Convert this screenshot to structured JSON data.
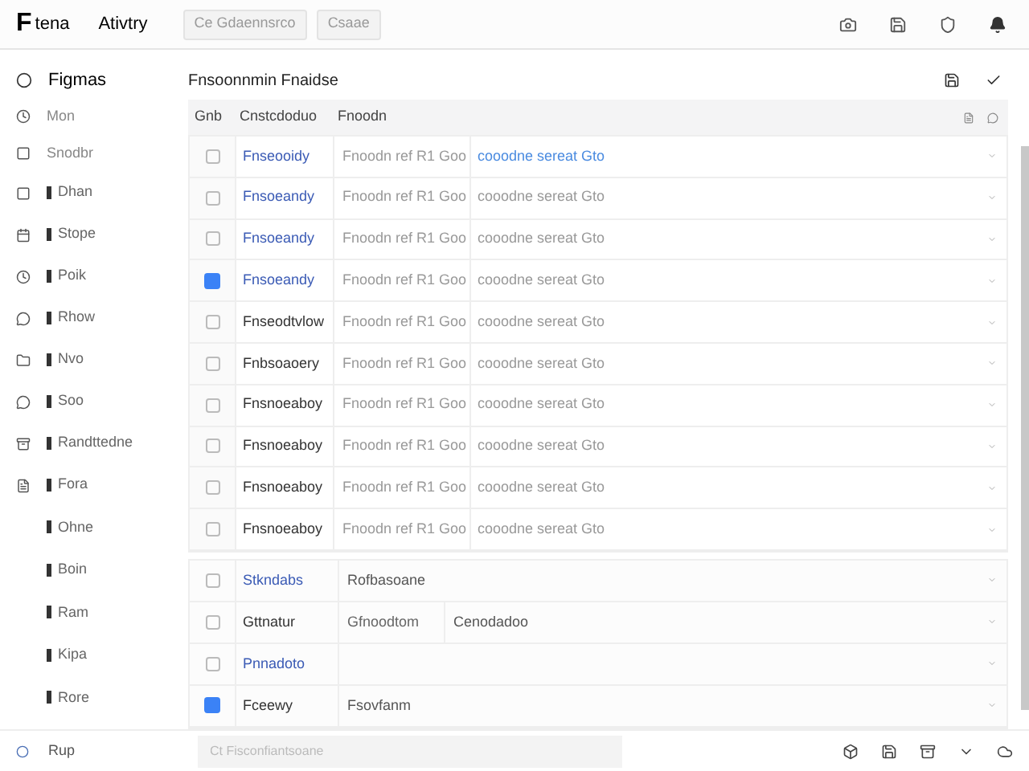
{
  "topbar": {
    "logo": "F",
    "app_name": "tena",
    "tab": "Ativtry",
    "buttons": [
      {
        "label": "Ce Gdaennsrco"
      },
      {
        "label": "Csaae"
      }
    ]
  },
  "sidebar": {
    "items": [
      {
        "label": "Figmas",
        "kind": "heading"
      },
      {
        "label": "Mon",
        "kind": "icon"
      },
      {
        "label": "Snodbr",
        "kind": "icon"
      },
      {
        "label": "Dhan",
        "kind": "sub-icon"
      },
      {
        "label": "Stope",
        "kind": "sub-icon"
      },
      {
        "label": "Poik",
        "kind": "sub-icon"
      },
      {
        "label": "Rhow",
        "kind": "sub-icon"
      },
      {
        "label": "Nvo",
        "kind": "sub-icon"
      },
      {
        "label": "Soo",
        "kind": "sub-icon"
      },
      {
        "label": "Randttedne",
        "kind": "sub-icon"
      },
      {
        "label": "Fora",
        "kind": "sub-icon"
      },
      {
        "label": "Ohne",
        "kind": "sub"
      },
      {
        "label": "Boin",
        "kind": "sub"
      },
      {
        "label": "Ram",
        "kind": "sub"
      },
      {
        "label": "Kipa",
        "kind": "sub"
      },
      {
        "label": "Rore",
        "kind": "sub"
      }
    ],
    "footer": "Rup"
  },
  "panel": {
    "title": "Fnsoonnmin Fnaidse",
    "columns": [
      "Gnb",
      "Cnstcdoduo",
      "Fnoodn"
    ],
    "rows": [
      {
        "name": "Fnseooidy",
        "col_3": "Fnoodn ref R1 Goo",
        "col_4": "cooodne sereat Gto",
        "link": true,
        "selected": false
      },
      {
        "name": "Fnsoeandy",
        "col_3": "Fnoodn ref R1 Goo",
        "col_4": "cooodne sereat Gto",
        "link": true,
        "selected": false
      },
      {
        "name": "Fnsoeandy",
        "col_3": "Fnoodn ref R1 Goo",
        "col_4": "cooodne sereat Gto",
        "link": true,
        "selected": false
      },
      {
        "name": "Fnsoeandy",
        "col_3": "Fnoodn ref R1 Goo",
        "col_4": "cooodne sereat Gto",
        "link": true,
        "selected": true
      },
      {
        "name": "Fnseodtvlow",
        "col_3": "Fnoodn ref R1 Goo",
        "col_4": "cooodne sereat Gto",
        "link": false,
        "selected": false
      },
      {
        "name": "Fnbsoaoery",
        "col_3": "Fnoodn ref R1 Goo",
        "col_4": "cooodne sereat Gto",
        "link": false,
        "selected": false
      },
      {
        "name": "Fnsnoeaboy",
        "col_3": "Fnoodn ref R1 Goo",
        "col_4": "cooodne sereat Gto",
        "link": false,
        "selected": false
      },
      {
        "name": "Fnsnoeaboy",
        "col_3": "Fnoodn ref R1 Goo",
        "col_4": "cooodne sereat Gto",
        "link": false,
        "selected": false
      },
      {
        "name": "Fnsnoeaboy",
        "col_3": "Fnoodn ref R1 Goo",
        "col_4": "cooodne sereat Gto",
        "link": false,
        "selected": false
      },
      {
        "name": "Fnsnoeaboy",
        "col_3": "Fnoodn ref R1 Goo",
        "col_4": "cooodne sereat Gto",
        "link": false,
        "selected": false
      }
    ],
    "group_rows": [
      {
        "name": "Stkndabs",
        "values": [
          "Rofbasoane"
        ],
        "link": true,
        "selected": false
      },
      {
        "name": "Gttnatur",
        "values": [
          "Gfnoodtom",
          "Cenodadoo"
        ],
        "link": false,
        "selected": false
      },
      {
        "name": "Pnnadoto",
        "values": [],
        "link": true,
        "selected": false
      },
      {
        "name": "Fceewy",
        "values": [
          "Fsovfanm"
        ],
        "link": false,
        "selected": true
      }
    ]
  },
  "bottombar": {
    "search": {
      "placeholder": "Ct Fisconfiantsoane"
    }
  }
}
